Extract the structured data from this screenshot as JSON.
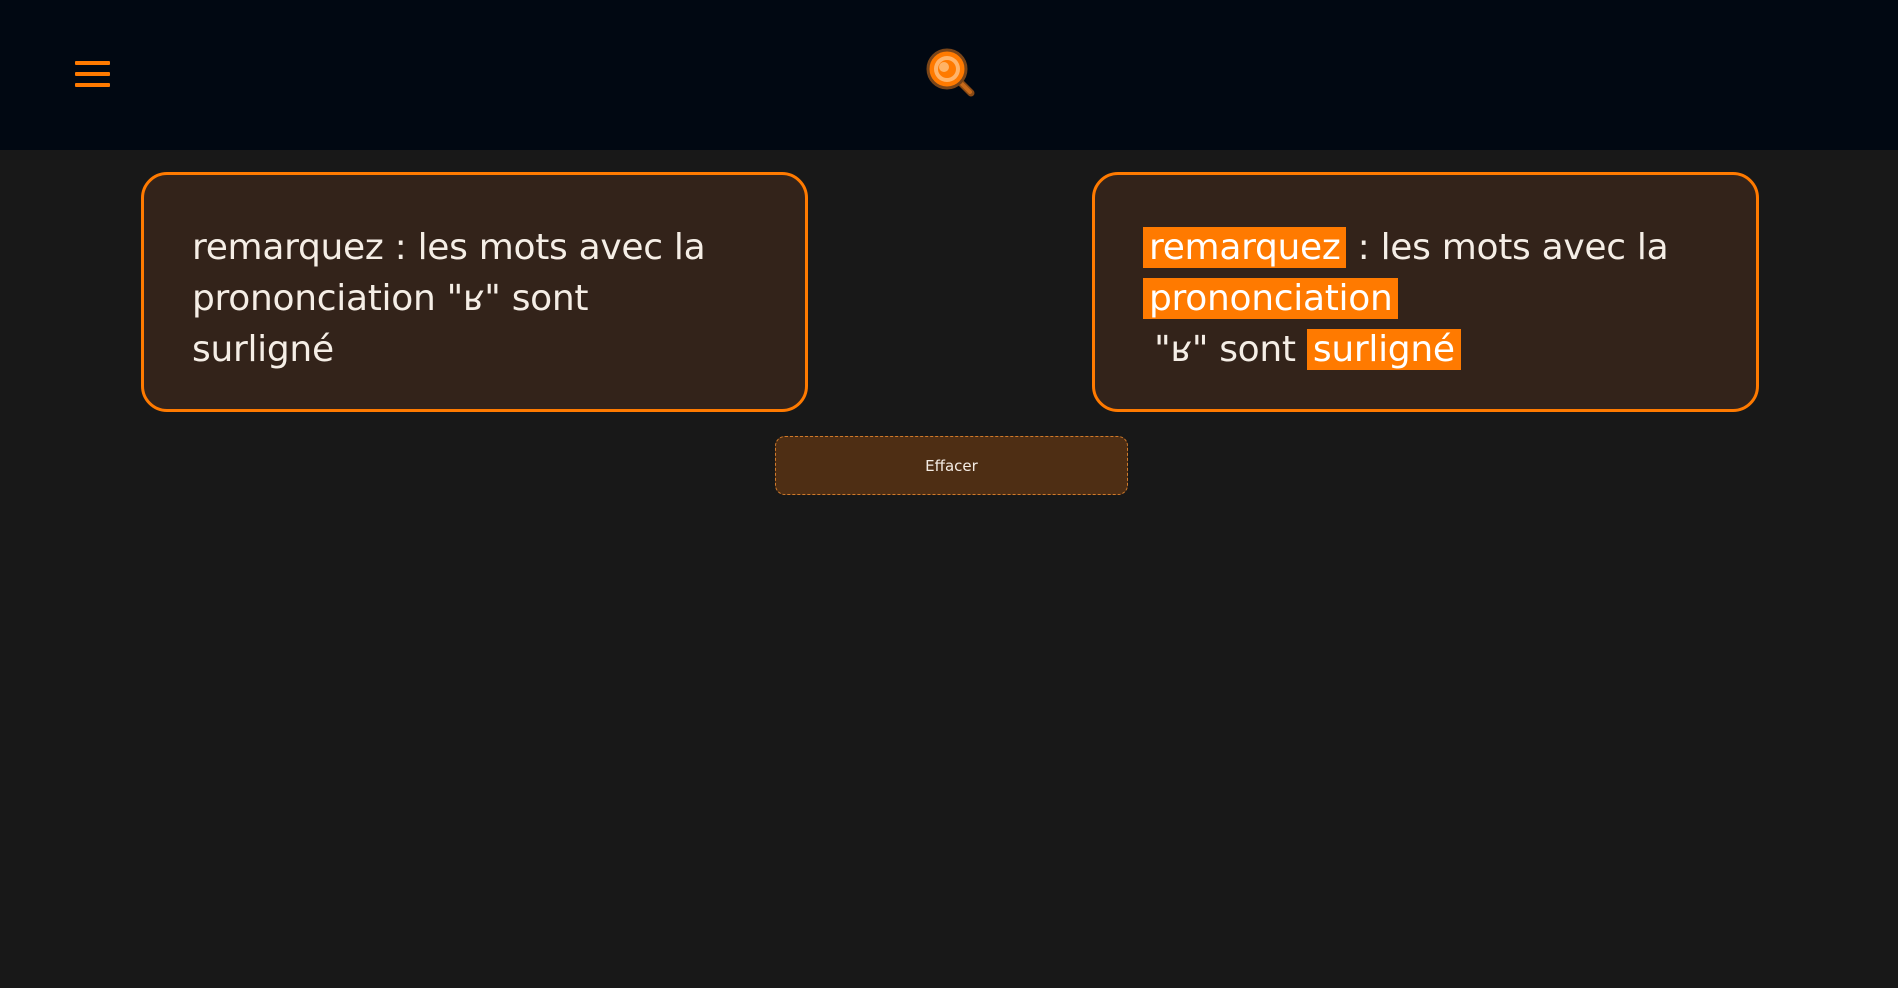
{
  "header": {
    "menu_icon": "hamburger-menu-icon",
    "logo_icon": "magnifier-logo-icon"
  },
  "input_panel": {
    "line1": "remarquez : les mots avec la",
    "line2": "prononciation \"ʁ\" sont surligné"
  },
  "output_panel": {
    "w1": "remarquez",
    "t1": " : les mots avec la",
    "w2": "prononciation",
    "t2": " \"ʁ\" sont ",
    "w3": "surligné"
  },
  "clear_button": {
    "label": "Effacer"
  },
  "colors": {
    "accent": "#ff7a00",
    "header_bg": "#010812",
    "page_bg": "#181818",
    "panel_bg": "#33231a",
    "button_bg": "#4e2e14"
  }
}
